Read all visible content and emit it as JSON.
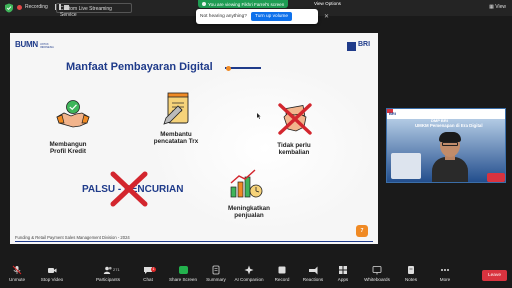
{
  "topbar": {
    "recording_label": "Recording",
    "stream_label": "Custom Live Streaming Service",
    "view_label": "View"
  },
  "banner": {
    "text": "You are viewing Fikhri Farrel's screen",
    "view_options": "View Options"
  },
  "toast": {
    "text": "Not hearing anything?",
    "button": "Turn up volume"
  },
  "slide": {
    "title": "Manfaat Pembayaran Digital",
    "logo_left": "BUMN",
    "logo_left_sub": "UNTUK INDONESIA",
    "logo_right": "BRI",
    "items": [
      {
        "label_line1": "Membangun",
        "label_line2": "Profil Kredit"
      },
      {
        "label_line1": "Membantu",
        "label_line2": "pencatatan Trx"
      },
      {
        "label_line1": "Tidak perlu",
        "label_line2": "kembalian"
      },
      {
        "label_line1": "Meningkatkan",
        "label_line2": "penjualan"
      }
    ],
    "palsu_text": "PALSU - PENCURIAN",
    "footer": "Funding & Retail Payment Sales Management Division - 2024",
    "page_number": "7"
  },
  "participant": {
    "bank_label": "BRI",
    "event_line1": "DMP BRI",
    "event_line2": "UMKM Pemenapan di Era Digital"
  },
  "toolbar": {
    "items": [
      {
        "label": "Unmute",
        "icon": "mic-muted-icon"
      },
      {
        "label": "Stop Video",
        "icon": "video-icon"
      },
      {
        "label": "Participants",
        "icon": "participants-icon",
        "count": "271"
      },
      {
        "label": "Chat",
        "icon": "chat-icon",
        "badge": "1"
      },
      {
        "label": "Share Screen",
        "icon": "share-screen-icon"
      },
      {
        "label": "Summary",
        "icon": "summary-icon"
      },
      {
        "label": "AI Companion",
        "icon": "ai-companion-icon"
      },
      {
        "label": "Record",
        "icon": "record-icon"
      },
      {
        "label": "Reactions",
        "icon": "reactions-icon"
      },
      {
        "label": "Apps",
        "icon": "apps-icon"
      },
      {
        "label": "Whiteboards",
        "icon": "whiteboard-icon"
      },
      {
        "label": "Notes",
        "icon": "notes-icon"
      },
      {
        "label": "More",
        "icon": "more-icon"
      }
    ],
    "leave_label": "Leave"
  },
  "colors": {
    "brand_blue": "#1f3b8a",
    "accent_orange": "#f08a24",
    "zoom_blue": "#0e71eb",
    "banner_green": "#1f9c53",
    "leave_red": "#d9333f"
  }
}
